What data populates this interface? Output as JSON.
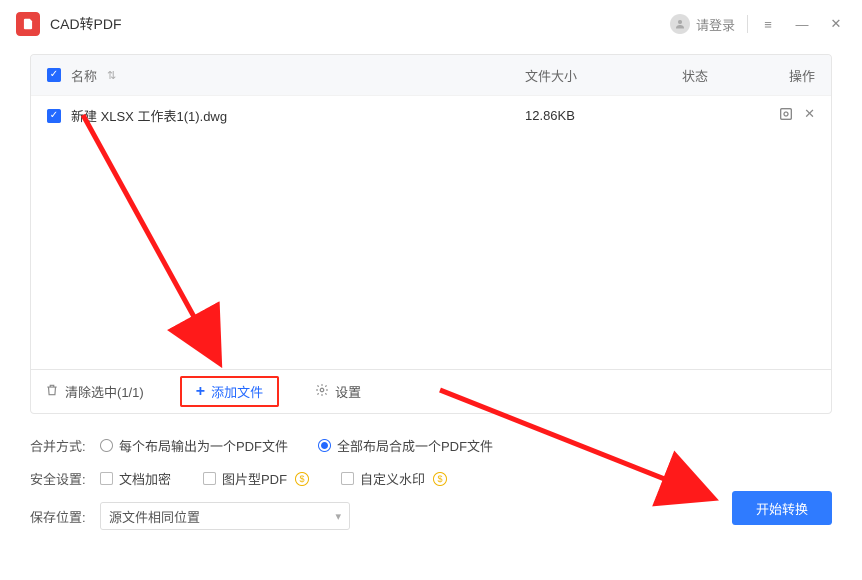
{
  "header": {
    "title": "CAD转PDF",
    "login_text": "请登录"
  },
  "table": {
    "cols": {
      "name": "名称",
      "size": "文件大小",
      "status": "状态",
      "action": "操作"
    },
    "rows": [
      {
        "checked": true,
        "name": "新建 XLSX 工作表1(1).dwg",
        "size": "12.86KB",
        "status": ""
      }
    ]
  },
  "panel_footer": {
    "clear_selected": "清除选中(1/1)",
    "add_file": "添加文件",
    "settings": "设置"
  },
  "options": {
    "merge_label": "合并方式:",
    "merge_opt1": "每个布局输出为一个PDF文件",
    "merge_opt2": "全部布局合成一个PDF文件",
    "security_label": "安全设置:",
    "sec_opt1": "文档加密",
    "sec_opt2": "图片型PDF",
    "sec_opt3": "自定义水印",
    "save_label": "保存位置:",
    "save_value": "源文件相同位置"
  },
  "actions": {
    "start": "开始转换"
  }
}
